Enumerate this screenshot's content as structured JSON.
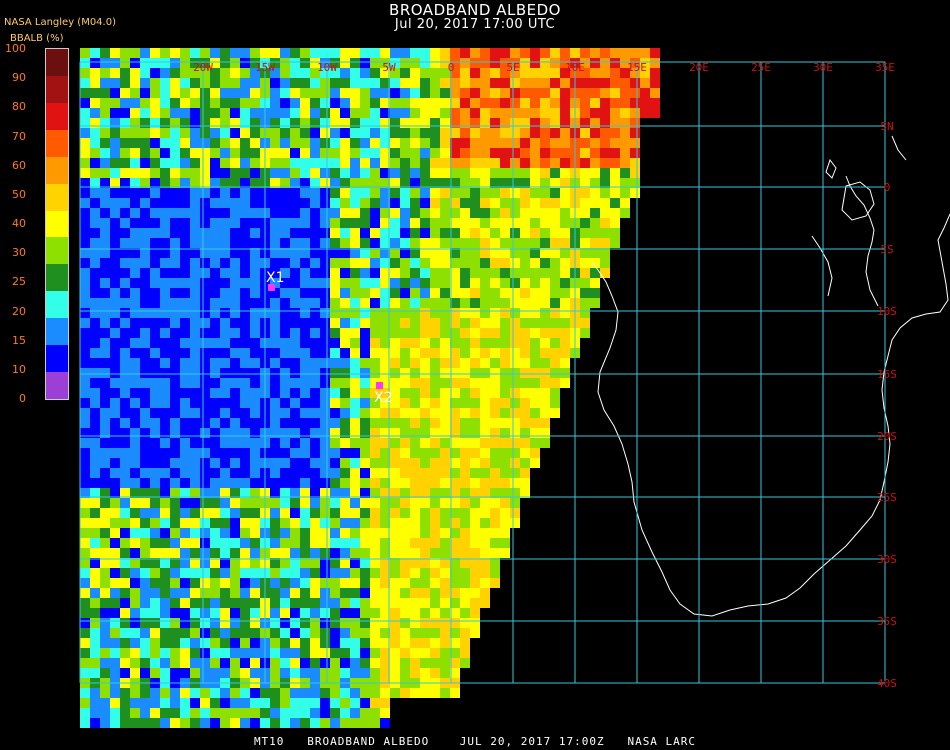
{
  "header": {
    "title": "BROADBAND ALBEDO",
    "subtitle": "Jul 20, 2017 17:00 UTC",
    "source": "NASA Langley (M04.0)",
    "units": "BBALB (%)"
  },
  "colorbar": {
    "ticks": [
      "100",
      "90",
      "80",
      "70",
      "60",
      "50",
      "40",
      "30",
      "25",
      "20",
      "15",
      "10",
      "0"
    ],
    "colors": [
      "#6b0f0f",
      "#a31212",
      "#e01212",
      "#ff5a00",
      "#ff9900",
      "#ffd200",
      "#ffff00",
      "#8ee000",
      "#1f8f1f",
      "#33ffe8",
      "#1a8cff",
      "#0000ff",
      "#9b3fd6"
    ],
    "tick_values": [
      100,
      90,
      80,
      70,
      60,
      50,
      40,
      30,
      25,
      20,
      15,
      10,
      0
    ]
  },
  "grid": {
    "lon_labels": [
      "20W",
      "15W",
      "10W",
      "5W",
      "0",
      "5E",
      "10E",
      "15E",
      "20E",
      "25E",
      "30E",
      "35E"
    ],
    "lat_labels": [
      "5N",
      "0",
      "5S",
      "10S",
      "15S",
      "20S",
      "25S",
      "30S",
      "35S",
      "40S"
    ],
    "line_color": "#36c8d8",
    "label_color": "#cc1111"
  },
  "markers": [
    {
      "label": "X1",
      "color": "#ff33ff"
    },
    {
      "label": "X2",
      "color": "#ff33ff"
    }
  ],
  "footer": {
    "text": "MT10   BROADBAND ALBEDO    JUL 20, 2017 17:00Z   NASA LARC"
  }
}
